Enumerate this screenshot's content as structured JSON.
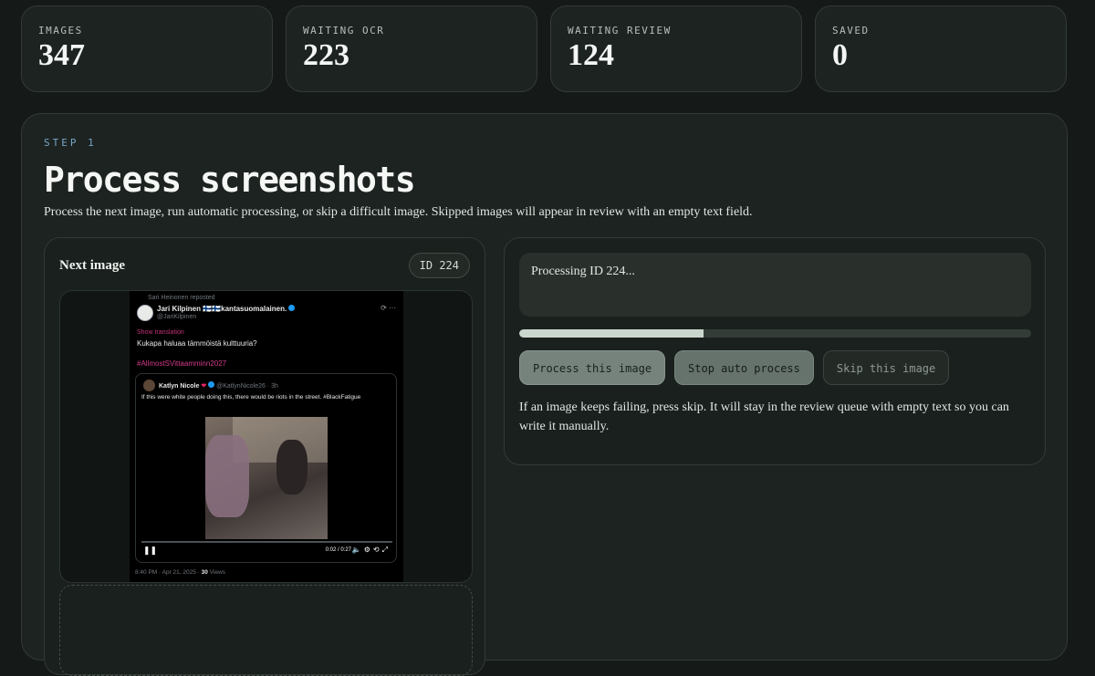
{
  "stats": [
    {
      "label": "IMAGES",
      "value": "347"
    },
    {
      "label": "WAITING OCR",
      "value": "223"
    },
    {
      "label": "WAITING REVIEW",
      "value": "124"
    },
    {
      "label": "SAVED",
      "value": "0"
    }
  ],
  "step": {
    "label": "STEP 1",
    "title": "Process screenshots",
    "subtitle": "Process the next image, run automatic processing, or skip a difficult image. Skipped images will appear in review with an empty text field."
  },
  "next_image": {
    "title": "Next image",
    "id_badge": "ID 224"
  },
  "tweet": {
    "repost": "Sari Heinonen reposted",
    "author": "Jari Kilpinen 🇫🇮🇫🇮kantasuomalainen.",
    "handle": "@JariKilpinen",
    "translate": "Show translation",
    "text": "Kukapa haluaa tämmöistä kulttuuria?",
    "hashtag": "#AllmostSVittaamminn2027",
    "quote_name": "Katlyn Nicole",
    "quote_handle": "@KatlynNicole26 · 3h",
    "quote_text": "If this were white people doing this, there would be riots in the street. #BlackFatigue",
    "video_time": "0:02 / 0:27",
    "meta_time": "8:40 PM · Apr 21, 2025 · ",
    "meta_views": "30",
    "meta_views_label": " Views"
  },
  "processing": {
    "status": "Processing ID 224...",
    "progress": 0.36,
    "buttons": {
      "process": "Process this image",
      "stop": "Stop auto process",
      "skip": "Skip this image"
    },
    "help": "If an image keeps failing, press skip. It will stay in the review queue with empty text so you can write it manually."
  },
  "colors": {
    "background": "#151a18",
    "card": "#1d2320",
    "accent_step": "#78a6c8",
    "progress_fill": "#cbd6cf"
  }
}
